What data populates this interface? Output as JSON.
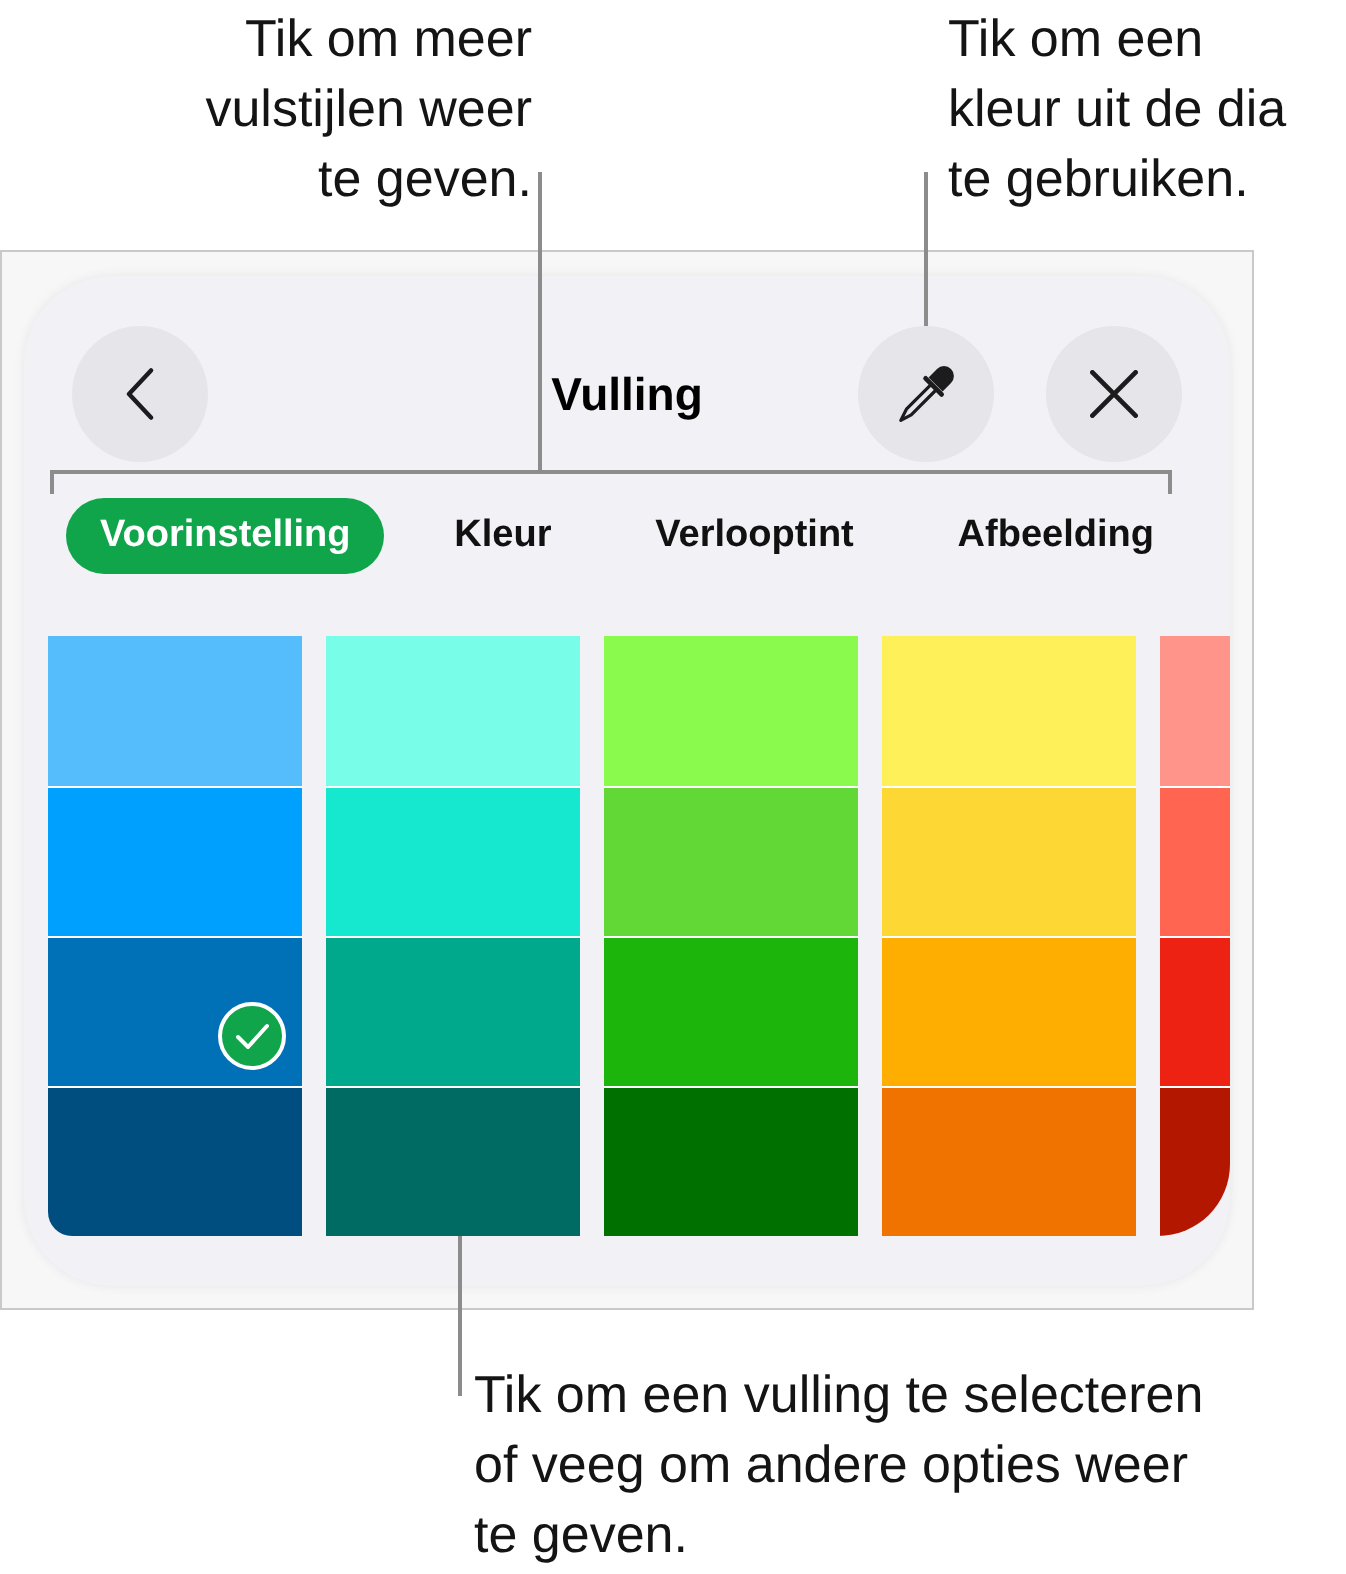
{
  "callouts": {
    "fill_styles": "Tik om meer vulstijlen weer te geven.",
    "eyedropper": "Tik om een kleur uit de dia te gebruiken.",
    "swatches": "Tik om een vulling te selecteren of veeg om andere opties weer te geven."
  },
  "panel": {
    "title": "Vulling",
    "tabs": [
      {
        "label": "Voorinstelling",
        "selected": true
      },
      {
        "label": "Kleur",
        "selected": false
      },
      {
        "label": "Verlooptint",
        "selected": false
      },
      {
        "label": "Afbeelding",
        "selected": false
      }
    ],
    "swatch_columns": [
      {
        "swatches": [
          {
            "color": "#56bdfd",
            "selected": false
          },
          {
            "color": "#00a1fe",
            "selected": false
          },
          {
            "color": "#0070b7",
            "selected": true
          },
          {
            "color": "#004d80",
            "selected": false
          }
        ]
      },
      {
        "swatches": [
          {
            "color": "#77fde8",
            "selected": false
          },
          {
            "color": "#16e8d0",
            "selected": false
          },
          {
            "color": "#00a88c",
            "selected": false
          },
          {
            "color": "#006b63",
            "selected": false
          }
        ]
      },
      {
        "swatches": [
          {
            "color": "#8afb4d",
            "selected": false
          },
          {
            "color": "#62d836",
            "selected": false
          },
          {
            "color": "#1cb50b",
            "selected": false
          },
          {
            "color": "#007000",
            "selected": false
          }
        ]
      },
      {
        "swatches": [
          {
            "color": "#fef058",
            "selected": false
          },
          {
            "color": "#fdd835",
            "selected": false
          },
          {
            "color": "#feae00",
            "selected": false
          },
          {
            "color": "#f07300",
            "selected": false
          }
        ]
      },
      {
        "swatches": [
          {
            "color": "#ff958a",
            "selected": false
          },
          {
            "color": "#ff6550",
            "selected": false
          },
          {
            "color": "#ee2212",
            "selected": false
          },
          {
            "color": "#b41700",
            "selected": false
          }
        ]
      }
    ]
  }
}
